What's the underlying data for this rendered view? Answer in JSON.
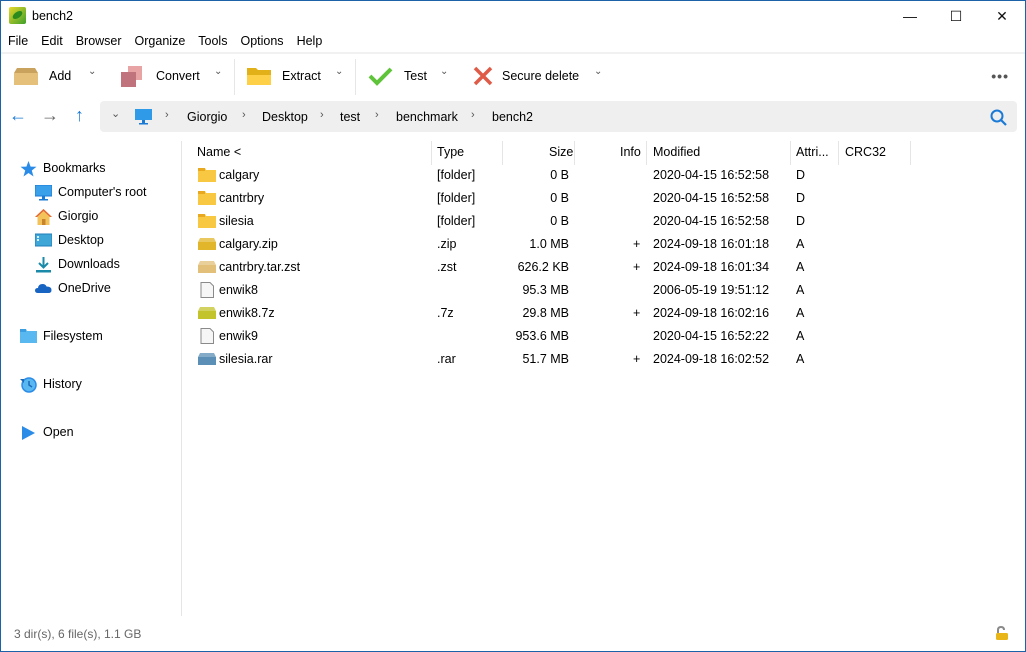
{
  "window": {
    "title": "bench2",
    "controls": {
      "minimize": "—",
      "maximize": "☐",
      "close": "✕"
    }
  },
  "menu": [
    "File",
    "Edit",
    "Browser",
    "Organize",
    "Tools",
    "Options",
    "Help"
  ],
  "toolbar": {
    "add": "Add",
    "convert": "Convert",
    "extract": "Extract",
    "test": "Test",
    "secure_delete": "Secure delete",
    "more": "•••",
    "chevron": "⌄"
  },
  "nav": {
    "back": "←",
    "forward": "→",
    "up": "↑",
    "history_chevron": "⌄",
    "sep": "›",
    "breadcrumb": [
      "Giorgio",
      "Desktop",
      "test",
      "benchmark",
      "bench2"
    ]
  },
  "sidebar": {
    "bookmarks": "Bookmarks",
    "items": [
      "Computer's root",
      "Giorgio",
      "Desktop",
      "Downloads",
      "OneDrive"
    ],
    "filesystem": "Filesystem",
    "history": "History",
    "open": "Open"
  },
  "columns": [
    "Name <",
    "Type",
    "Size",
    "Info",
    "Modified",
    "Attri...",
    "CRC32"
  ],
  "files": [
    {
      "name": "calgary",
      "type": "[folder]",
      "size": "0 B",
      "info": "",
      "modified": "2020-04-15 16:52:58",
      "attr": "D",
      "crc": "",
      "icon": "folder"
    },
    {
      "name": "cantrbry",
      "type": "[folder]",
      "size": "0 B",
      "info": "",
      "modified": "2020-04-15 16:52:58",
      "attr": "D",
      "crc": "",
      "icon": "folder"
    },
    {
      "name": "silesia",
      "type": "[folder]",
      "size": "0 B",
      "info": "",
      "modified": "2020-04-15 16:52:58",
      "attr": "D",
      "crc": "",
      "icon": "folder"
    },
    {
      "name": "calgary.zip",
      "type": ".zip",
      "size": "1.0 MB",
      "info": "+",
      "modified": "2024-09-18 16:01:18",
      "attr": "A",
      "crc": "",
      "icon": "archive-zip"
    },
    {
      "name": "cantrbry.tar.zst",
      "type": ".zst",
      "size": "626.2 KB",
      "info": "+",
      "modified": "2024-09-18 16:01:34",
      "attr": "A",
      "crc": "",
      "icon": "archive-zst"
    },
    {
      "name": "enwik8",
      "type": "",
      "size": "95.3 MB",
      "info": "",
      "modified": "2006-05-19 19:51:12",
      "attr": "A",
      "crc": "",
      "icon": "file"
    },
    {
      "name": "enwik8.7z",
      "type": ".7z",
      "size": "29.8 MB",
      "info": "+",
      "modified": "2024-09-18 16:02:16",
      "attr": "A",
      "crc": "",
      "icon": "archive-7z"
    },
    {
      "name": "enwik9",
      "type": "",
      "size": "953.6 MB",
      "info": "",
      "modified": "2020-04-15 16:52:22",
      "attr": "A",
      "crc": "",
      "icon": "file"
    },
    {
      "name": "silesia.rar",
      "type": ".rar",
      "size": "51.7 MB",
      "info": "+",
      "modified": "2024-09-18 16:02:52",
      "attr": "A",
      "crc": "",
      "icon": "archive-rar"
    }
  ],
  "icon_colors": {
    "folder": "#f8c843",
    "archive-zip": "#e2b62b",
    "archive-zst": "#e2c07a",
    "archive-7z": "#c3c32c",
    "archive-rar": "#5b8fb5",
    "file": "#f6f6f6",
    "accent": "#1a7ad6"
  },
  "status": {
    "summary": "3 dir(s), 6 file(s), 1.1 GB"
  }
}
